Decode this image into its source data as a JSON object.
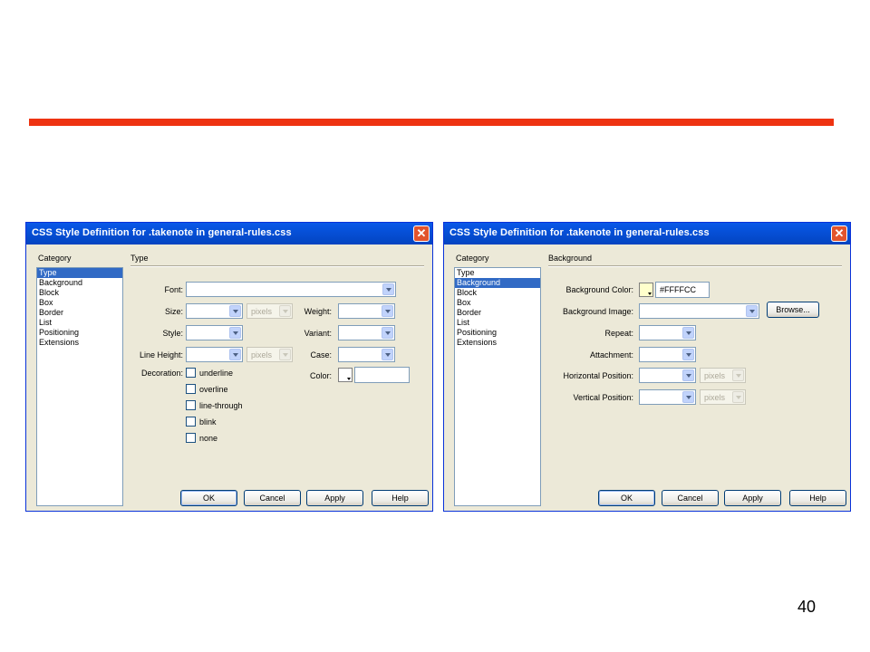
{
  "page_number": "40",
  "colors": {
    "rule": "#ee3311",
    "titlebar": "#0650d8",
    "dialog_bg": "#ece9d8",
    "selected": "#316ac5"
  },
  "dialog_left": {
    "title": "CSS Style Definition for .takenote in general-rules.css",
    "category_header": "Category",
    "categories": [
      "Type",
      "Background",
      "Block",
      "Box",
      "Border",
      "List",
      "Positioning",
      "Extensions"
    ],
    "selected_category": "Type",
    "panel_title": "Type",
    "labels": {
      "font": "Font:",
      "size": "Size:",
      "style": "Style:",
      "line_height": "Line Height:",
      "weight": "Weight:",
      "variant": "Variant:",
      "case": "Case:",
      "color": "Color:",
      "decoration": "Decoration:"
    },
    "units": {
      "size": "pixels",
      "line_height": "pixels"
    },
    "decorations": [
      "underline",
      "overline",
      "line-through",
      "blink",
      "none"
    ],
    "buttons": {
      "ok": "OK",
      "cancel": "Cancel",
      "apply": "Apply",
      "help": "Help"
    }
  },
  "dialog_right": {
    "title": "CSS Style Definition for .takenote in general-rules.css",
    "category_header": "Category",
    "categories": [
      "Type",
      "Background",
      "Block",
      "Box",
      "Border",
      "List",
      "Positioning",
      "Extensions"
    ],
    "selected_category": "Background",
    "panel_title": "Background",
    "labels": {
      "bg_color": "Background Color:",
      "bg_image": "Background Image:",
      "repeat": "Repeat:",
      "attachment": "Attachment:",
      "h_position": "Horizontal Position:",
      "v_position": "Vertical Position:"
    },
    "bg_color_value": "#FFFFCC",
    "bg_color_swatch": "#ffffcc",
    "browse_label": "Browse...",
    "units": {
      "h_position": "pixels",
      "v_position": "pixels"
    },
    "buttons": {
      "ok": "OK",
      "cancel": "Cancel",
      "apply": "Apply",
      "help": "Help"
    }
  }
}
